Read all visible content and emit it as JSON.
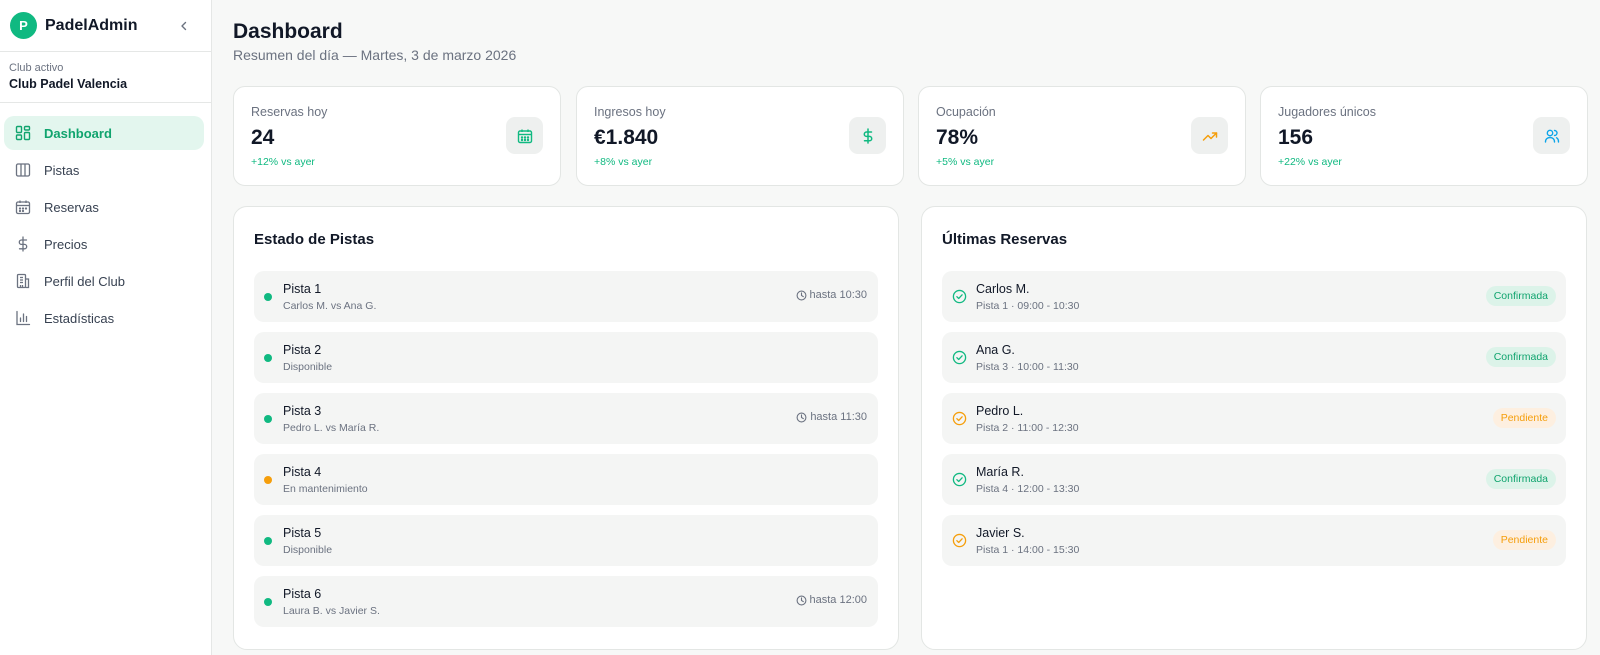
{
  "brand": {
    "initial": "P",
    "name": "PadelAdmin"
  },
  "club": {
    "caption": "Club activo",
    "name": "Club Padel Valencia"
  },
  "nav": [
    {
      "label": "Dashboard",
      "icon": "dashboard-icon",
      "active": true
    },
    {
      "label": "Pistas",
      "icon": "courts-icon",
      "active": false
    },
    {
      "label": "Reservas",
      "icon": "calendar-icon",
      "active": false
    },
    {
      "label": "Precios",
      "icon": "dollar-icon",
      "active": false
    },
    {
      "label": "Perfil del Club",
      "icon": "building-icon",
      "active": false
    },
    {
      "label": "Estadísticas",
      "icon": "bar-chart-icon",
      "active": false
    }
  ],
  "header": {
    "title": "Dashboard",
    "subtitle": "Resumen del día — Martes, 3 de marzo 2026"
  },
  "stats": [
    {
      "label": "Reservas hoy",
      "value": "24",
      "delta": "+12% vs ayer",
      "icon": "calendar-icon",
      "icon_color": "#10b981"
    },
    {
      "label": "Ingresos hoy",
      "value": "€1.840",
      "delta": "+8% vs ayer",
      "icon": "dollar-icon",
      "icon_color": "#10b981"
    },
    {
      "label": "Ocupación",
      "value": "78%",
      "delta": "+5% vs ayer",
      "icon": "trending-up-icon",
      "icon_color": "#f59e0b"
    },
    {
      "label": "Jugadores únicos",
      "value": "156",
      "delta": "+22% vs ayer",
      "icon": "users-icon",
      "icon_color": "#0ea5e9"
    }
  ],
  "courts_panel": {
    "title": "Estado de Pistas",
    "items": [
      {
        "name": "Pista 1",
        "detail": "Carlos M. vs Ana G.",
        "time": "hasta 10:30",
        "status_color": "#10b981"
      },
      {
        "name": "Pista 2",
        "detail": "Disponible",
        "time": "",
        "status_color": "#10b981"
      },
      {
        "name": "Pista 3",
        "detail": "Pedro L. vs María R.",
        "time": "hasta 11:30",
        "status_color": "#10b981"
      },
      {
        "name": "Pista 4",
        "detail": "En mantenimiento",
        "time": "",
        "status_color": "#f59e0b"
      },
      {
        "name": "Pista 5",
        "detail": "Disponible",
        "time": "",
        "status_color": "#10b981"
      },
      {
        "name": "Pista 6",
        "detail": "Laura B. vs Javier S.",
        "time": "hasta 12:00",
        "status_color": "#10b981"
      }
    ]
  },
  "reservations_panel": {
    "title": "Últimas Reservas",
    "items": [
      {
        "name": "Carlos M.",
        "detail": "Pista 1 · 09:00 - 10:30",
        "status": "Confirmada",
        "kind": "confirmed"
      },
      {
        "name": "Ana G.",
        "detail": "Pista 3 · 10:00 - 11:30",
        "status": "Confirmada",
        "kind": "confirmed"
      },
      {
        "name": "Pedro L.",
        "detail": "Pista 2 · 11:00 - 12:30",
        "status": "Pendiente",
        "kind": "pending"
      },
      {
        "name": "María R.",
        "detail": "Pista 4 · 12:00 - 13:30",
        "status": "Confirmada",
        "kind": "confirmed"
      },
      {
        "name": "Javier S.",
        "detail": "Pista 1 · 14:00 - 15:30",
        "status": "Pendiente",
        "kind": "pending"
      }
    ]
  },
  "colors": {
    "accent": "#10b981",
    "pending": "#f59e0b"
  }
}
